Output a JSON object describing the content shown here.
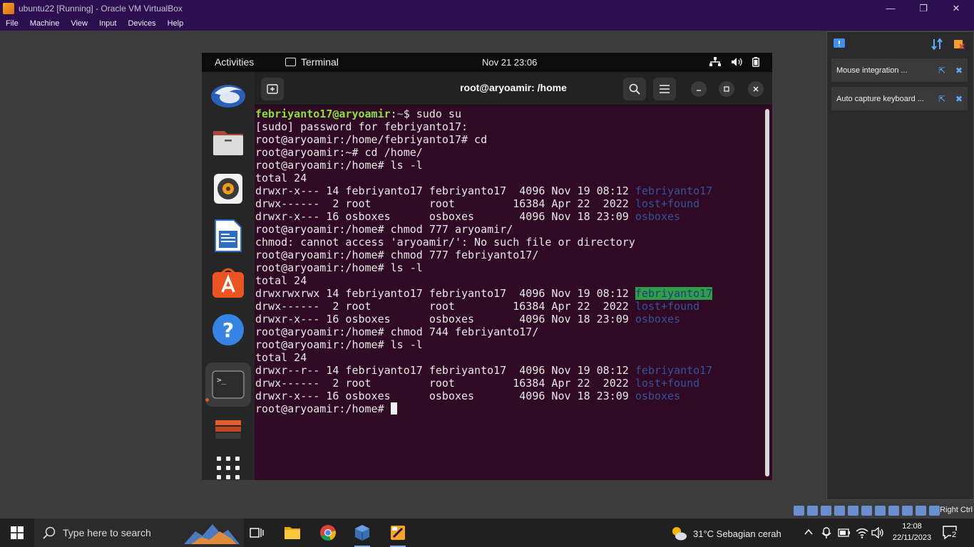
{
  "host": {
    "title": "ubuntu22 [Running] - Oracle VM VirtualBox",
    "menu": [
      "File",
      "Machine",
      "View",
      "Input",
      "Devices",
      "Help"
    ],
    "window_controls": {
      "minimize": "—",
      "restore": "❐",
      "close": "✕"
    },
    "notifications": [
      {
        "text": "Mouse integration ..."
      },
      {
        "text": "Auto capture keyboard ..."
      }
    ],
    "host_key": "Right Ctrl"
  },
  "guest": {
    "topbar": {
      "activities": "Activities",
      "app_name": "Terminal",
      "clock": "Nov 21  23:06"
    },
    "dock": [
      "thunderbird-icon",
      "files-icon",
      "rhythmbox-icon",
      "writer-icon",
      "app-center-icon",
      "help-icon",
      "terminal-icon",
      "disk-icon",
      "app-grid-icon"
    ],
    "terminal": {
      "title": "root@aryoamir: /home",
      "lines": [
        {
          "user": "febriyanto17@aryoamir",
          "path": "~",
          "sym": "$ ",
          "cmd": "sudo su"
        },
        {
          "text": "[sudo] password for febriyanto17:"
        },
        {
          "text": "root@aryoamir:/home/febriyanto17# cd"
        },
        {
          "text": "root@aryoamir:~# cd /home/"
        },
        {
          "text": "root@aryoamir:/home# ls -l"
        },
        {
          "text": "total 24"
        },
        {
          "text": "drwxr-x--- 14 febriyanto17 febriyanto17  4096 Nov 19 08:12 ",
          "dir": "febriyanto17"
        },
        {
          "text": "drwx------  2 root         root         16384 Apr 22  2022 ",
          "dir": "lost+found"
        },
        {
          "text": "drwxr-x--- 16 osboxes      osboxes       4096 Nov 18 23:09 ",
          "dir": "osboxes"
        },
        {
          "text": "root@aryoamir:/home# chmod 777 aryoamir/"
        },
        {
          "text": "chmod: cannot access 'aryoamir/': No such file or directory"
        },
        {
          "text": "root@aryoamir:/home# chmod 777 febriyanto17/"
        },
        {
          "text": "root@aryoamir:/home# ls -l"
        },
        {
          "text": "total 24"
        },
        {
          "text": "drwxrwxrwx 14 febriyanto17 febriyanto17  4096 Nov 19 08:12 ",
          "dir": "febriyanto17",
          "hl": true
        },
        {
          "text": "drwx------  2 root         root         16384 Apr 22  2022 ",
          "dir": "lost+found"
        },
        {
          "text": "drwxr-x--- 16 osboxes      osboxes       4096 Nov 18 23:09 ",
          "dir": "osboxes"
        },
        {
          "text": "root@aryoamir:/home# chmod 744 febriyanto17/"
        },
        {
          "text": "root@aryoamir:/home# ls -l"
        },
        {
          "text": "total 24"
        },
        {
          "text": "drwxr--r-- 14 febriyanto17 febriyanto17  4096 Nov 19 08:12 ",
          "dir": "febriyanto17"
        },
        {
          "text": "drwx------  2 root         root         16384 Apr 22  2022 ",
          "dir": "lost+found"
        },
        {
          "text": "drwxr-x--- 16 osboxes      osboxes       4096 Nov 18 23:09 ",
          "dir": "osboxes"
        },
        {
          "text": "root@aryoamir:/home# ",
          "cursor": true
        }
      ]
    }
  },
  "taskbar": {
    "search_placeholder": "Type here to search",
    "weather": "31°C  Sebagian cerah",
    "time": "12:08",
    "date": "22/11/2023",
    "notification_count": "2"
  },
  "colors": {
    "terminal_bg": "#300a24",
    "vbox_purple": "#2b0f4f",
    "prompt_user": "#8ae234",
    "prompt_path": "#729fcf",
    "dir": "#34539a",
    "ubuntu_orange": "#e95420"
  }
}
